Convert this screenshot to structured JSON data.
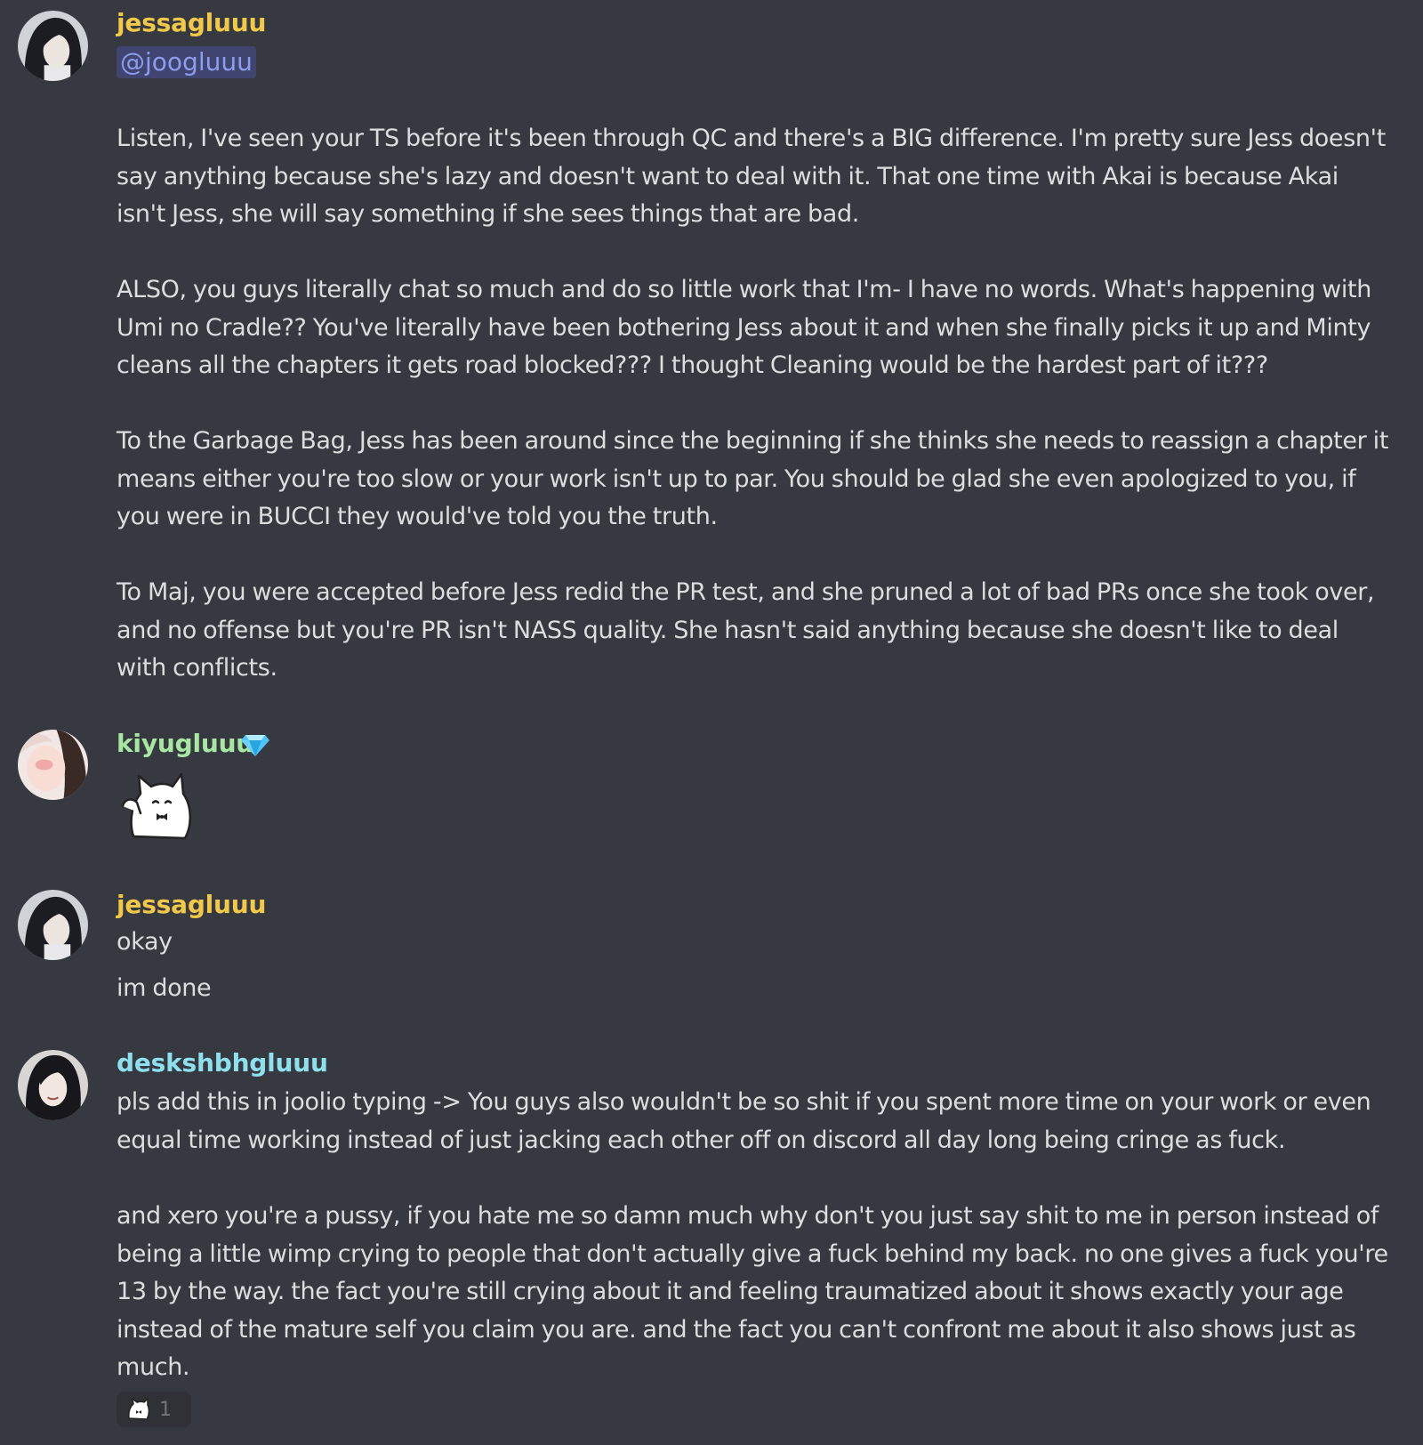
{
  "colors": {
    "background": "#36393f",
    "text": "#dcddde",
    "username_gold": "#f2c84b",
    "username_green": "#a8e6a3",
    "username_cyan": "#8fe0ee",
    "mention_text": "#8e9cf0"
  },
  "messages": [
    {
      "username": "jessagluuu",
      "mention": "@joogluuu",
      "paragraphs": [
        [
          "Listen, I've seen your TS before it's been through QC and there's a BIG difference. I'm pretty sure Jess doesn't",
          "say anything because she's lazy and doesn't want to deal with it. That one time with Akai is because Akai",
          "isn't Jess, she will say something if she sees things that are bad."
        ],
        [
          "ALSO, you guys literally chat so much and do so little work that I'm- I have no words. What's happening with",
          "Umi no Cradle?? You've literally have been bothering Jess about it and when she finally picks it up and Minty",
          "cleans all the chapters it gets road blocked??? I thought Cleaning would be the hardest part of it???"
        ],
        [
          "To the Garbage Bag, Jess has been around since the beginning if she thinks she needs to reassign a chapter it",
          "means either you're too slow or your work isn't up to par. You should be glad she even apologized to you, if",
          "you were in BUCCI they would've told you the truth."
        ],
        [
          "To Maj, you were accepted before Jess redid the PR test, and she pruned a lot of bad PRs once she took over,",
          "and no offense but you're PR isn't NASS quality. She hasn't said anything because she doesn't like to deal",
          "with conflicts."
        ]
      ]
    },
    {
      "username": "kiyugluuu",
      "badge_icon": "diamond-icon",
      "sticker_icon": "cat-sticker-icon"
    },
    {
      "username": "jessagluuu",
      "lines": [
        "okay",
        "im done"
      ]
    },
    {
      "username": "deskshbhgluuu",
      "paragraphs": [
        [
          "pls add this in joolio typing -> You guys also wouldn't be so shit if you spent more time on your work or even",
          "equal time working instead of just jacking each other off on discord all day long being cringe as fuck."
        ],
        [
          "and xero you're a pussy, if you hate me so damn much why don't you just say shit to me in person instead of",
          "being a little wimp crying to people that don't actually give a fuck behind my back. no one gives a fuck you're",
          "13 by the way. the fact you're still crying about it and feeling traumatized about it shows exactly your age",
          "instead of the mature self you claim you are. and the fact you can't confront me about it also shows just as",
          "much."
        ]
      ],
      "reaction": {
        "emoji_icon": "cat-reaction-icon",
        "count": "1"
      }
    }
  ]
}
